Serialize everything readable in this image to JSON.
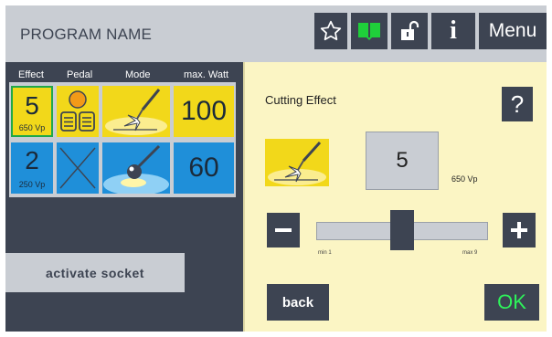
{
  "header": {
    "program_name": "PROGRAM NAME",
    "menu_label": "Menu",
    "icons": [
      "star-icon",
      "book-icon",
      "unlock-icon",
      "info-icon"
    ],
    "info_label": "i"
  },
  "table": {
    "columns": [
      "Effect",
      "Pedal",
      "Mode",
      "max. Watt"
    ],
    "rows": [
      {
        "effect": "5",
        "effect_sub": "650 Vp",
        "pedal_icon": "pedal-dual-icon",
        "mode_icon": "cutting-mode-icon",
        "watt": "100",
        "color": "#f2d81a"
      },
      {
        "effect": "2",
        "effect_sub": "250 Vp",
        "pedal_icon": "none-x-icon",
        "mode_icon": "ball-electrode-icon",
        "watt": "60",
        "color": "#1f8fd9"
      }
    ]
  },
  "activate_socket_label": "activate socket",
  "panel": {
    "title": "Cutting Effect",
    "help_label": "?",
    "mode_icon": "cutting-mode-icon",
    "value": "5",
    "value_sub": "650 Vp",
    "slider": {
      "min": 1,
      "max": 9,
      "value": 5,
      "min_label": "min 1",
      "max_label": "max 9"
    },
    "back_label": "back",
    "ok_label": "OK"
  },
  "colors": {
    "dark": "#3d4452",
    "light_gray": "#c9cdd3",
    "yellow": "#f2d81a",
    "blue": "#1f8fd9",
    "panel_bg": "#fbf5c4",
    "ok_green": "#2ef25a",
    "book_green": "#1fcf3a"
  }
}
